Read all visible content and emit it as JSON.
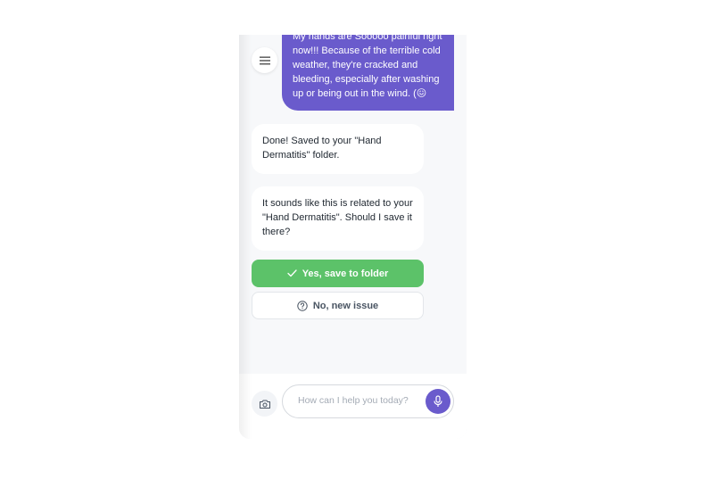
{
  "header": {
    "menu_icon": "hamburger-menu-icon"
  },
  "messages": {
    "user_1": "My hands are Sooooo painful right now!!! Because of the terrible cold weather, they're cracked and bleeding, especially after washing up or being out in the wind. (😖",
    "bot_1": "Done! Saved to your \"Hand Dermatitis\" folder.",
    "bot_2": "It sounds like this is related to your \"Hand Dermatitis\". Should I save it there?"
  },
  "actions": {
    "yes_label": "Yes, save to folder",
    "yes_icon": "check-icon",
    "no_label": "No, new issue",
    "no_icon": "question-circle-icon"
  },
  "composer": {
    "placeholder": "How can I help you today?",
    "camera_icon": "camera-icon",
    "mic_icon": "microphone-icon"
  },
  "colors": {
    "accent": "#6a5bcc",
    "success": "#5cc269",
    "background": "#f7f8fa"
  }
}
